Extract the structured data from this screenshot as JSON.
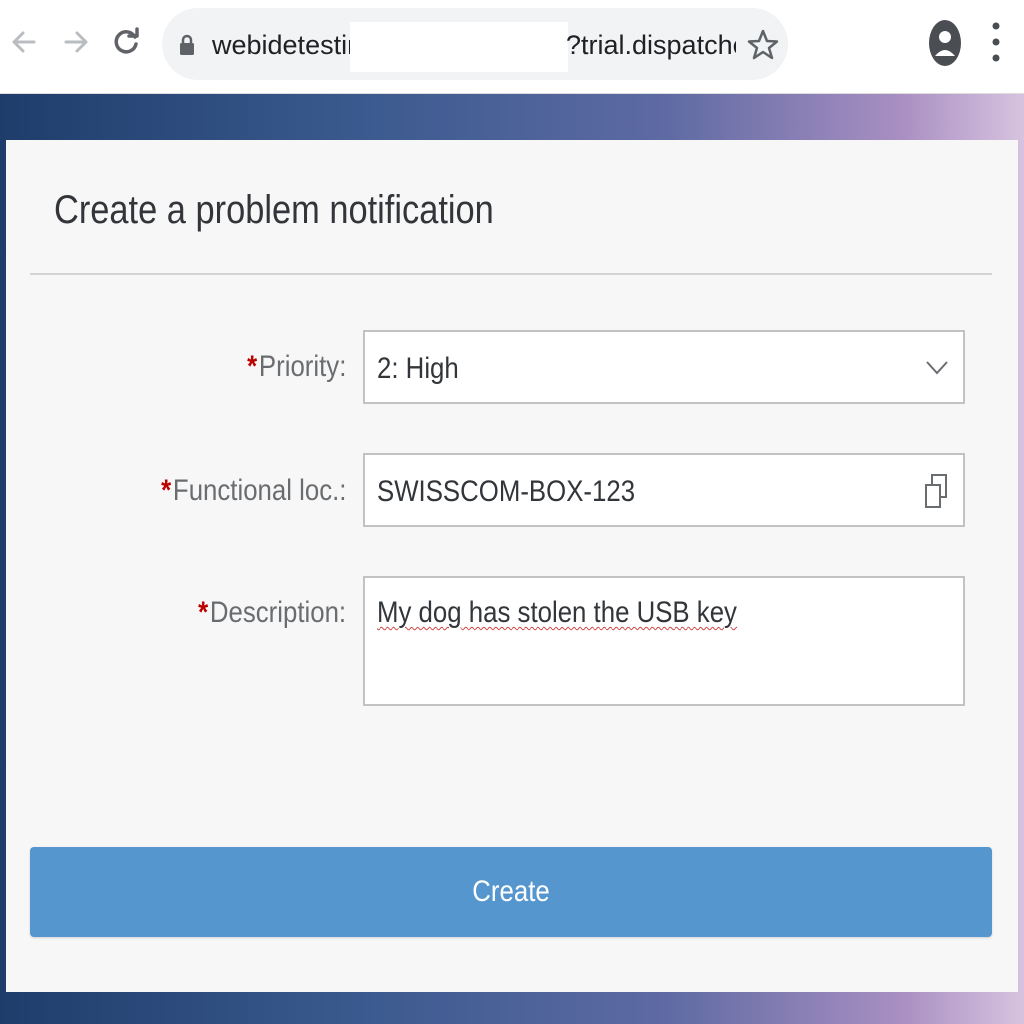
{
  "browser": {
    "url_left": "webidetesting",
    "url_right": "?trial.dispatche..."
  },
  "card": {
    "title": "Create a problem notification"
  },
  "form": {
    "priority": {
      "label": "Priority:",
      "required_mark": "*",
      "value": "2: High"
    },
    "functional_location": {
      "label": "Functional loc.:",
      "required_mark": "*",
      "value": "SWISSCOM-BOX-123"
    },
    "description": {
      "label": "Description:",
      "required_mark": "*",
      "value": "My dog has stolen the USB key"
    }
  },
  "actions": {
    "create_label": "Create"
  },
  "colors": {
    "primary_button": "#5596cf",
    "required_asterisk": "#bb0000"
  }
}
